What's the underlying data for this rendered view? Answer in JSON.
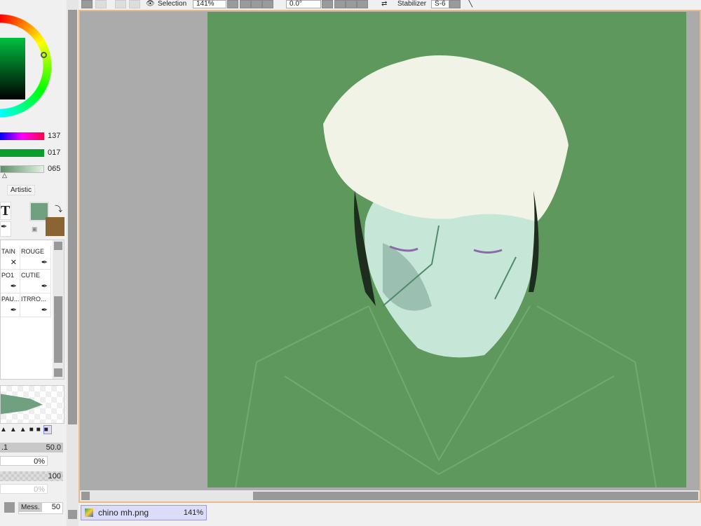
{
  "toolbar": {
    "selection_label": "Selection",
    "zoom_value": "141%",
    "rotation_value": "0.0°",
    "stabilizer_label": "Stabilizer",
    "stabilizer_value": "S-6"
  },
  "color": {
    "sliders": [
      {
        "value": "137"
      },
      {
        "value": "017"
      },
      {
        "value": "065"
      }
    ],
    "tab_artistic": "Artistic",
    "primary": "#6fa080",
    "secondary": "#8a6432"
  },
  "tools": {
    "text_tool": "T"
  },
  "brushes": [
    {
      "label": "TAIN"
    },
    {
      "label": "ROUGE"
    },
    {
      "label": "PO1"
    },
    {
      "label": "CUTIE"
    },
    {
      "label": "PAU..."
    },
    {
      "label": "ITRRO..."
    }
  ],
  "brush_settings": {
    "size_value": "50.0",
    "size_min": ".1",
    "min_size_pct": "0%",
    "density": "100",
    "blend_pct": "0%",
    "mess_label": "Mess.",
    "mess_value": "50"
  },
  "file_tab": {
    "name": "chino mh.png",
    "zoom": "141%"
  }
}
